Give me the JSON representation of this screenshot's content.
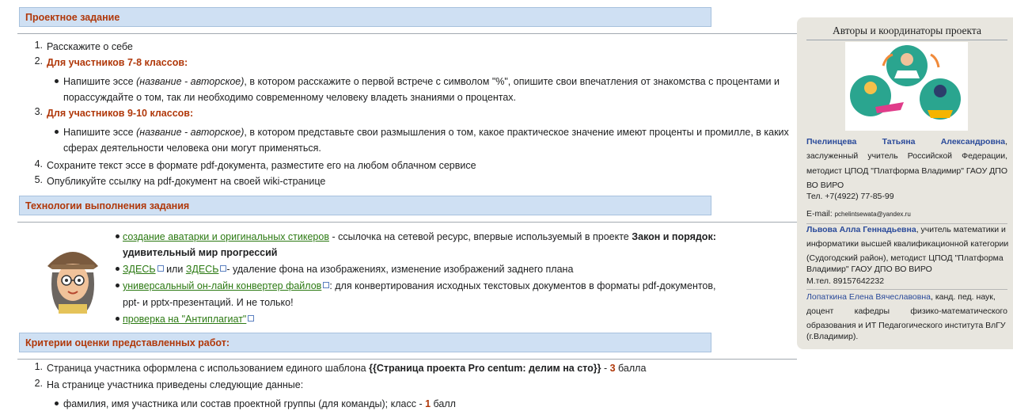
{
  "sections": {
    "task_title": "Проектное задание",
    "tech_title": "Технологии выполнения задания",
    "criteria_title": "Критерии оценки представленных работ:"
  },
  "task": {
    "item1": "Расскажите о себе",
    "item2": "Для участников 7-8 классов:",
    "item2_b_pre": "Напишите эссе ",
    "item2_b_ital": "(название - авторское)",
    "item2_b_post": ", в котором расскажите о первой встрече с символом \"%\", опишите свои впечатления от знакомства с процентами и",
    "item2_b_line2": "порассуждайте о том, так ли необходимо современному человеку владеть знаниями о процентах.",
    "item3": "Для участников 9-10 классов:",
    "item3_b_pre": "Напишите эссе ",
    "item3_b_ital": "(название - авторское)",
    "item3_b_post": ", в котором представьте свои размышления о том, какое практическое значение имеют проценты и промилле, в каких",
    "item3_b_line2": "сферах деятельности человека они могут применяться.",
    "item4": "Сохраните текст эссе в формате pdf-документа, разместите его на любом облачном сервисе",
    "item5": "Опубликуйте ссылку на pdf-документ на своей wiki-странице"
  },
  "tech": {
    "b1_link": "создание аватарки и оригинальных стикеров",
    "b1_text": " - ссылочка на сетевой ресурс, впервые используемый в проекте ",
    "b1_bold": "Закон и порядок:",
    "b1_bold2": "удивительный мир прогрессий",
    "b2_link1": "ЗДЕСЬ",
    "b2_mid": " или ",
    "b2_link2": "ЗДЕСЬ",
    "b2_text": "- удаление фона на изображениях, изменение изображений заднего плана",
    "b3_link": "универсальный он-лайн конвертер файлов",
    "b3_text": ": для конвертирования исходных текстовых документов в форматы pdf-документов,",
    "b3_line2": "ppt- и pptx-презентаций. И не только!",
    "b4_link": "проверка на \"Антиплагиат\""
  },
  "criteria": {
    "c1_text": "Страница участника оформлена с использованием единого шаблона ",
    "c1_bold": "{{Страница проекта Pro centum: делим на сто}}",
    "c1_dash": " - ",
    "c1_score": "3",
    "c1_unit": " балла",
    "c2_text": "На странице участника приведены следующие данные:",
    "c2_b1_text": "фамилия, имя участника или состав проектной группы (для команды); класс - ",
    "c2_b1_score": "1",
    "c2_b1_unit": " балл"
  },
  "numbers": {
    "n1": "1.",
    "n2": "2.",
    "n3": "3.",
    "n4": "4.",
    "n5": "5."
  },
  "sidebar": {
    "title": "Авторы и координаторы проекта",
    "a1_name": "Пчелинцева Татьяна Александровна",
    "a1_l1_end": ",",
    "a1_l2": "заслуженный учитель Российской Федерации,",
    "a1_l3": "методист ЦПОД \"Платформа Владимир\" ГАОУ ДПО",
    "a1_l4": "ВО ВИРО",
    "a1_phone": "Тел. +7(4922) 77-85-99",
    "a1_email_label": "E-mail: ",
    "a1_email": "pchelintsewata@yandex.ru",
    "a2_name": "Львова Алла Геннадьевна",
    "a2_l1": ", учитель математики и",
    "a2_l2": "информатики высшей квалификационной категории",
    "a2_l3": "(Судогодский район), методист ЦПОД \"Платформа",
    "a2_l4": "Владимир\" ГАОУ ДПО ВО ВИРО",
    "a2_phone": "М.тел. 89157642232",
    "a3_name": "Лопаткина Елена Вячеславовна",
    "a3_l1": ", канд. пед. наук,",
    "a3_l2": "доцент кафедры физико-математического",
    "a3_l3": "образования и ИТ Педагогического института ВлГУ",
    "a3_l4": "(г.Владимир)."
  }
}
